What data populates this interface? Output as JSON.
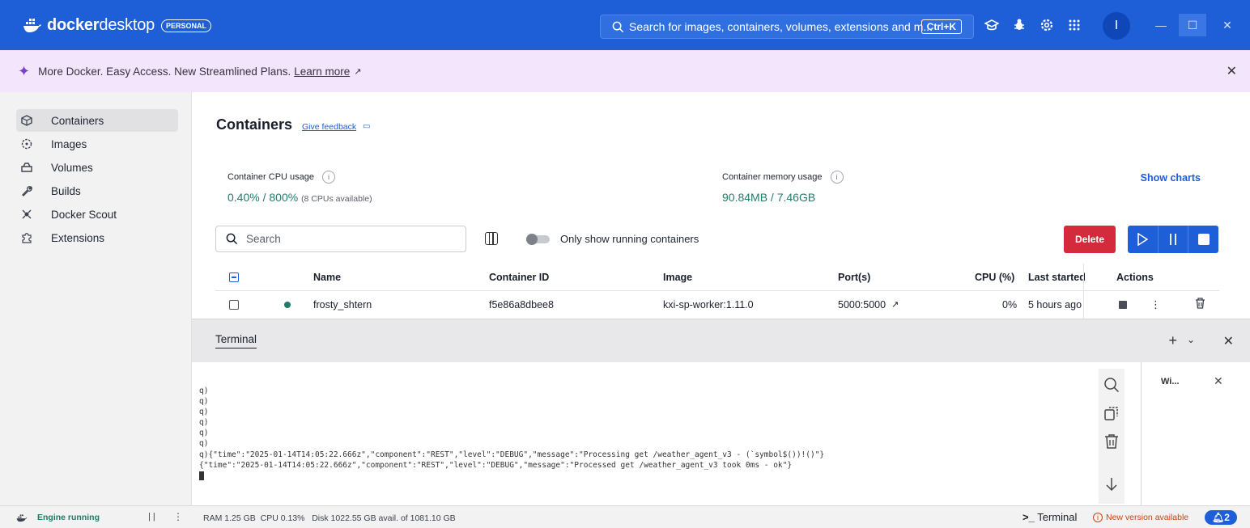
{
  "app": {
    "brand_docker": "docker",
    "brand_desktop": "desktop",
    "plan_badge": "PERSONAL",
    "search_placeholder": "Search for images, containers, volumes, extensions and m...",
    "search_shortcut": "Ctrl+K",
    "avatar_letter": "I",
    "accent_color": "#1e5ed6"
  },
  "banner": {
    "text": "More Docker. Easy Access. New Streamlined Plans.",
    "link": "Learn more"
  },
  "sidebar": {
    "items": [
      {
        "label": "Containers",
        "icon": "container-icon",
        "active": true
      },
      {
        "label": "Images",
        "icon": "images-icon"
      },
      {
        "label": "Volumes",
        "icon": "volumes-icon"
      },
      {
        "label": "Builds",
        "icon": "builds-icon"
      },
      {
        "label": "Docker Scout",
        "icon": "scout-icon"
      },
      {
        "label": "Extensions",
        "icon": "extensions-icon"
      }
    ]
  },
  "main": {
    "title": "Containers",
    "feedback": "Give feedback",
    "cpu": {
      "label": "Container CPU usage",
      "value": "0.40% / 800%",
      "note": "(8 CPUs available)"
    },
    "memory": {
      "label": "Container memory usage",
      "value": "90.84MB / 7.46GB"
    },
    "show_charts": "Show charts",
    "search_placeholder": "Search",
    "toggle_label": "Only show running containers",
    "delete_label": "Delete",
    "columns": [
      "Name",
      "Container ID",
      "Image",
      "Port(s)",
      "CPU (%)",
      "Last started",
      "Actions"
    ],
    "rows": [
      {
        "name": "frosty_shtern",
        "id": "f5e86a8dbee8",
        "image": "kxi-sp-worker:1.11.0",
        "ports": "5000:5000",
        "cpu": "0%",
        "last_started": "5 hours ago"
      }
    ]
  },
  "terminal": {
    "tab": "Terminal",
    "side_tab": "Wi...",
    "lines": [
      "q)",
      "q)",
      "q)",
      "q)",
      "q)",
      "q)",
      "q){\"time\":\"2025-01-14T14:05:22.666z\",\"component\":\"REST\",\"level\":\"DEBUG\",\"message\":\"Processing get /weather_agent_v3 - (`symbol$())!()\"}",
      "{\"time\":\"2025-01-14T14:05:22.666z\",\"component\":\"REST\",\"level\":\"DEBUG\",\"message\":\"Processed get /weather_agent_v3 took 0ms - ok\"}"
    ]
  },
  "footer": {
    "engine": "Engine running",
    "stats": "RAM 1.25 GB  CPU 0.13%   Disk 1022.55 GB avail. of 1081.10 GB",
    "terminal_link": "Terminal",
    "new_version": "New version available",
    "notifications": "2"
  }
}
